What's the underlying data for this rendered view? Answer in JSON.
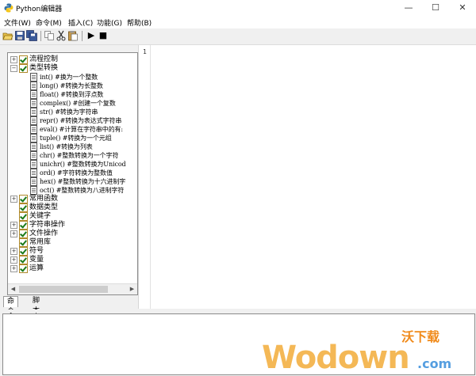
{
  "window": {
    "title": "Python编辑器",
    "controls": {
      "minimize": "—",
      "maximize": "☐",
      "close": "✕"
    }
  },
  "menubar": [
    "文件(W)",
    "命令(M)",
    "插入(C)",
    "功能(G)",
    "帮助(B)"
  ],
  "toolbar": {
    "buttons": [
      "open-icon",
      "save-icon",
      "save-all-icon",
      "copy-icon",
      "cut-icon",
      "paste-icon",
      "run-icon",
      "stop-icon"
    ],
    "run_glyph": "▶",
    "stop_glyph": "■"
  },
  "tree": {
    "nodes": [
      {
        "label": "流程控制",
        "expanded": false
      },
      {
        "label": "类型转换",
        "expanded": true,
        "children": [
          "int() #换为一个整数",
          "long() #转换为长整数",
          "float() #转换到浮点数",
          "complex() #创建一个复数",
          "str() #转换为字符串",
          "repr() #转换为表达式字符串",
          "eval() #计算在字符串中的有:",
          "tuple() #转换为一个元组",
          "list() #转换为列表",
          "chr() #整数转换为一个字符",
          "unichr() #整数转换为Unicod",
          "ord() #字符转换为整数值",
          "hex() #整数转换为十六进制字",
          "oct() #整数转换为八进制字符"
        ]
      },
      {
        "label": "常用函数",
        "expanded": false
      },
      {
        "label": "数据类型",
        "expanded": false,
        "leaf": true
      },
      {
        "label": "关键字",
        "expanded": false,
        "leaf": true
      },
      {
        "label": "字符串操作",
        "expanded": false
      },
      {
        "label": "文件操作",
        "expanded": false
      },
      {
        "label": "常用库",
        "expanded": false,
        "leaf": true
      },
      {
        "label": "符号",
        "expanded": false
      },
      {
        "label": "变量",
        "expanded": false
      },
      {
        "label": "运算",
        "expanded": false
      }
    ],
    "expander_collapsed": "+",
    "expander_expanded": "−"
  },
  "tabs": {
    "commands": "命令",
    "scripts": "脚本"
  },
  "editor": {
    "line_numbers": [
      "1"
    ]
  },
  "watermark": {
    "text": "Wodown.com",
    "chinese": "沃下载",
    "dotcom": ".com"
  }
}
